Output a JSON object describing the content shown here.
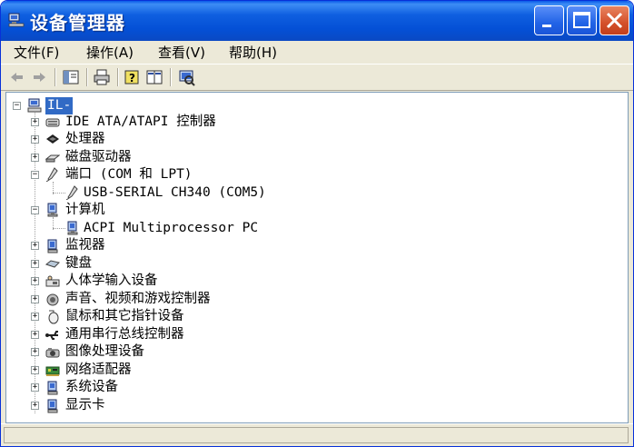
{
  "window": {
    "title": "设备管理器",
    "minimize_icon": "minimize-icon",
    "maximize_icon": "maximize-icon",
    "close_icon": "close-icon"
  },
  "menu": {
    "items": [
      {
        "label": "文件(F)"
      },
      {
        "label": "操作(A)"
      },
      {
        "label": "查看(V)"
      },
      {
        "label": "帮助(H)"
      }
    ]
  },
  "toolbar": {
    "icons": [
      "back-arrow-icon",
      "forward-arrow-icon",
      "show-hide-tree-icon",
      "print-icon",
      "help-icon",
      "properties-icon",
      "scan-hardware-icon"
    ]
  },
  "tree": {
    "root": {
      "label": "IL-",
      "icon": "computer-icon"
    },
    "items": [
      {
        "label": "IDE ATA/ATAPI 控制器",
        "icon": "ide-controller-icon",
        "expanded": false
      },
      {
        "label": "处理器",
        "icon": "processor-icon",
        "expanded": false
      },
      {
        "label": "磁盘驱动器",
        "icon": "disk-drive-icon",
        "expanded": false
      },
      {
        "label": "端口 (COM 和 LPT)",
        "icon": "port-icon",
        "expanded": true,
        "children": [
          {
            "label": "USB-SERIAL CH340 (COM5)",
            "icon": "port-icon"
          }
        ]
      },
      {
        "label": "计算机",
        "icon": "computer-device-icon",
        "expanded": true,
        "children": [
          {
            "label": "ACPI Multiprocessor PC",
            "icon": "computer-device-icon"
          }
        ]
      },
      {
        "label": "监视器",
        "icon": "monitor-icon",
        "expanded": false
      },
      {
        "label": "键盘",
        "icon": "keyboard-icon",
        "expanded": false
      },
      {
        "label": "人体学输入设备",
        "icon": "hid-icon",
        "expanded": false
      },
      {
        "label": "声音、视频和游戏控制器",
        "icon": "sound-icon",
        "expanded": false
      },
      {
        "label": "鼠标和其它指针设备",
        "icon": "mouse-icon",
        "expanded": false
      },
      {
        "label": "通用串行总线控制器",
        "icon": "usb-icon",
        "expanded": false
      },
      {
        "label": "图像处理设备",
        "icon": "imaging-icon",
        "expanded": false
      },
      {
        "label": "网络适配器",
        "icon": "network-adapter-icon",
        "expanded": false
      },
      {
        "label": "系统设备",
        "icon": "system-device-icon",
        "expanded": false
      },
      {
        "label": "显示卡",
        "icon": "display-adapter-icon",
        "expanded": false
      }
    ]
  },
  "colors": {
    "titlebar": "#0a5ae8",
    "selection": "#316ac5",
    "chrome": "#ece9d8"
  }
}
